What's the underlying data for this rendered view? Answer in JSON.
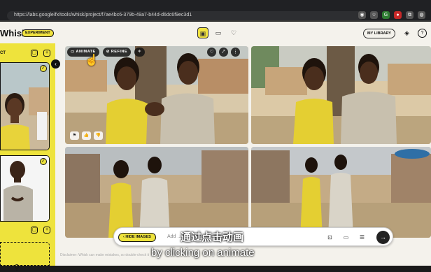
{
  "browser": {
    "url": "https://labs.google/fx/tools/whisk/project/f7ae4bc6-379b-49a7-b44d-d6dc6f9ec3d1"
  },
  "header": {
    "brand": "Whisk",
    "badge": "EXPERIMENT",
    "my_library": "MY LIBRARY"
  },
  "sidebar": {
    "section_label": "CT"
  },
  "image_toolbar": {
    "animate": "ANIMATE",
    "refine": "REFINE"
  },
  "prompt": {
    "hide_images": "HIDE IMAGES",
    "placeholder": "Add ... fter is eating an ice cream\")"
  },
  "disclaimer": "Disclaimer: Whisk can make mistakes, so double-check it",
  "subtitles": {
    "chinese": "通过点击动画",
    "english": "by clicking on animate"
  },
  "colors": {
    "accent": "#eee33c",
    "app_bg": "#f4f2ec"
  }
}
